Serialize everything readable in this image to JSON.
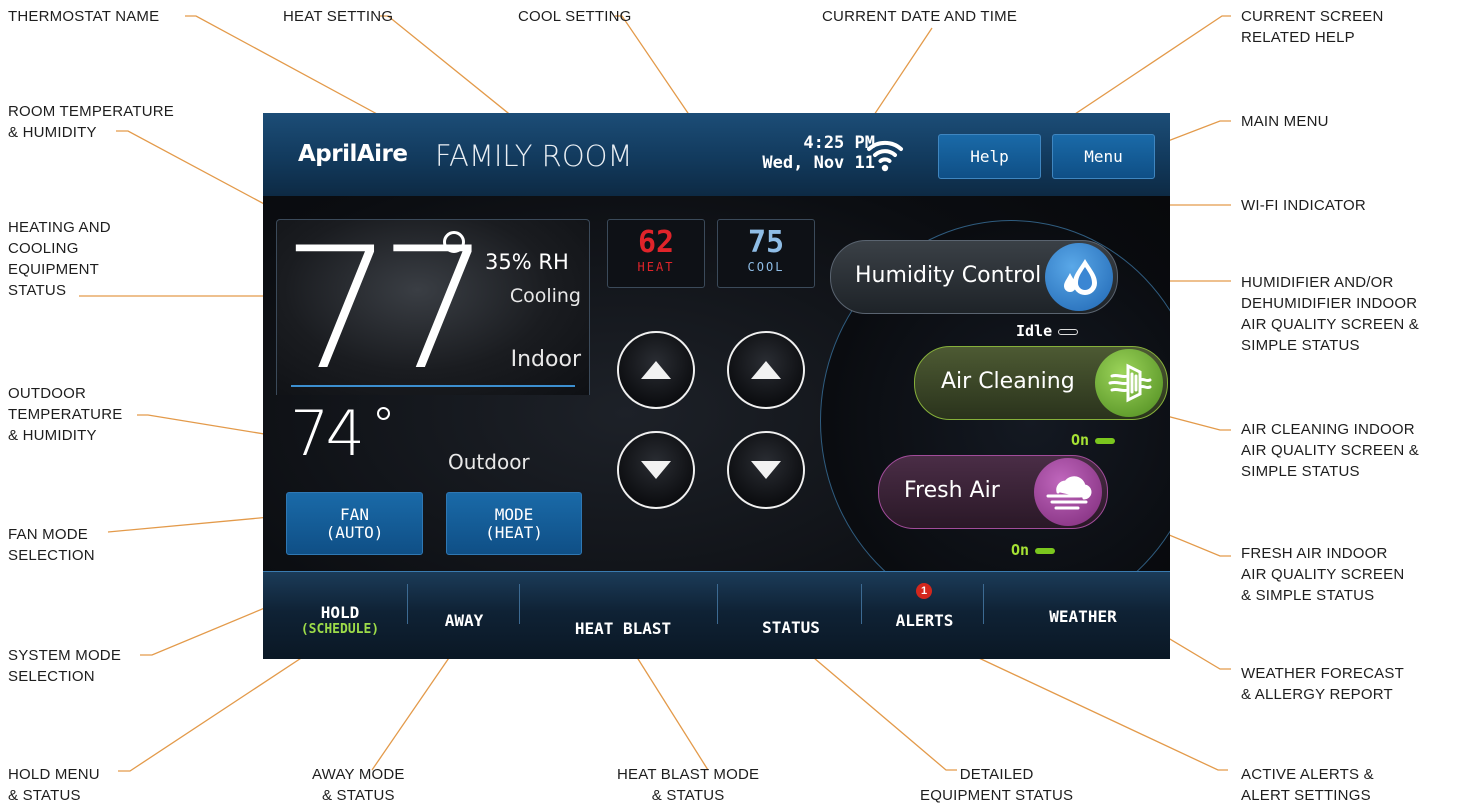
{
  "callouts": {
    "thermostat_name": "THERMOSTAT NAME",
    "heat_setting": "HEAT SETTING",
    "cool_setting": "COOL SETTING",
    "current_date_time": "CURRENT DATE AND TIME",
    "current_screen_help": "CURRENT SCREEN\nRELATED HELP",
    "room_temp_humidity": "ROOM TEMPERATURE\n& HUMIDITY",
    "main_menu": "MAIN MENU",
    "heating_cooling_status": "HEATING AND\nCOOLING\nEQUIPMENT\nSTATUS",
    "wifi_indicator": "WI-FI INDICATOR",
    "humidifier_status": "HUMIDIFIER AND/OR\nDEHUMIDIFIER INDOOR\nAIR QUALITY SCREEN &\nSIMPLE STATUS",
    "outdoor_temp_humidity": "OUTDOOR\nTEMPERATURE\n& HUMIDITY",
    "air_cleaning_status": "AIR CLEANING INDOOR\nAIR QUALITY SCREEN &\nSIMPLE STATUS",
    "fan_mode_selection": "FAN MODE\nSELECTION",
    "fresh_air_status": "FRESH AIR INDOOR\nAIR QUALITY SCREEN\n& SIMPLE STATUS",
    "system_mode_selection": "SYSTEM MODE\nSELECTION",
    "weather_forecast": "WEATHER FORECAST\n& ALLERGY REPORT",
    "hold_menu": "HOLD MENU\n& STATUS",
    "away_mode": "AWAY MODE\n& STATUS",
    "heat_blast_mode": "HEAT BLAST MODE\n& STATUS",
    "detailed_equipment": "DETAILED\nEQUIPMENT STATUS",
    "active_alerts": "ACTIVE ALERTS &\nALERT SETTINGS"
  },
  "screen": {
    "brand": "AprilAire",
    "room_name": "FAMILY ROOM",
    "time": "4:25 PM",
    "date": "Wed, Nov 11",
    "help_label": "Help",
    "menu_label": "Menu",
    "indoor_temp": "77",
    "humidity": "35% RH",
    "equipment_status": "Cooling",
    "indoor_label": "Indoor",
    "outdoor_temp": "74",
    "outdoor_label": "Outdoor",
    "fan": {
      "title": "FAN",
      "value": "(AUTO)"
    },
    "mode": {
      "title": "MODE",
      "value": "(HEAT)"
    },
    "heat_setpoint": "62",
    "heat_label": "HEAT",
    "cool_setpoint": "75",
    "cool_label": "COOL",
    "humidity_control": {
      "label": "Humidity Control",
      "state": "Idle"
    },
    "air_cleaning": {
      "label": "Air Cleaning",
      "state": "On"
    },
    "fresh_air": {
      "label": "Fresh Air",
      "state": "On"
    },
    "nav": {
      "hold": "HOLD",
      "hold_sub": "(SCHEDULE)",
      "away": "AWAY",
      "heat_blast": "HEAT BLAST",
      "status": "STATUS",
      "alerts": "ALERTS",
      "alerts_count": "1",
      "weather": "WEATHER"
    }
  },
  "colors": {
    "leader_line": "#e39a4a",
    "heat": "#e0242a",
    "cool": "#8fbde6",
    "accent_blue": "#1a6aa8",
    "status_green": "#a6e234"
  }
}
